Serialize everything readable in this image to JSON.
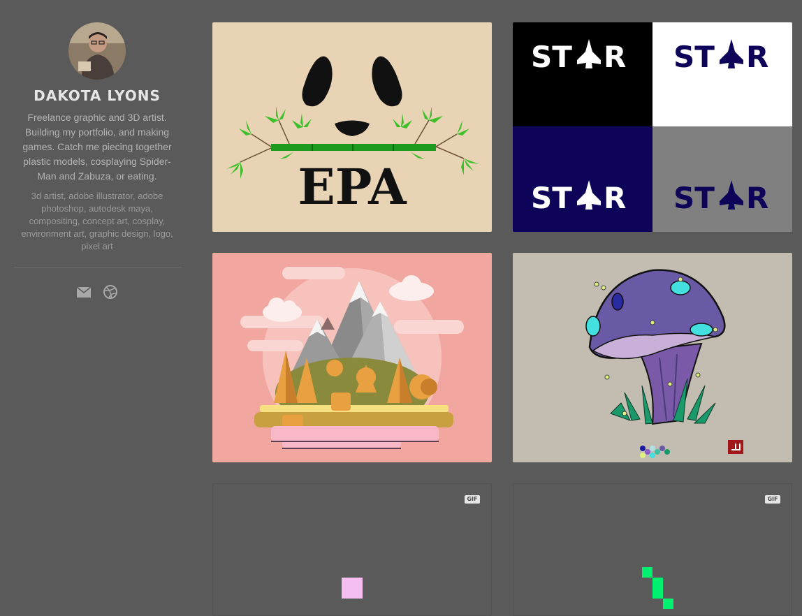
{
  "profile": {
    "name": "DAKOTA LYONS",
    "bio": "Freelance graphic and 3D artist. Building my portfolio, and making games. Catch me piecing together plastic models, cosplaying Spider-Man and Zabuza, or eating.",
    "tags": "3d artist, adobe illustrator, adobe photoshop, autodesk maya, compositing, concept art, cosplay, environment art, graphic design, logo, pixel art"
  },
  "social": [
    {
      "icon": "mail-icon"
    },
    {
      "icon": "dribbble-icon"
    }
  ],
  "projects": [
    {
      "title": "EPA",
      "art_text": "EPA"
    },
    {
      "title": "STAR",
      "art_text": "ST",
      "art_text_end": "R"
    },
    {
      "title": "Mountain landscape"
    },
    {
      "title": "Mushroom"
    },
    {
      "badge": "GIF"
    },
    {
      "badge": "GIF"
    }
  ],
  "colors": {
    "background": "#5a5a5a",
    "epa_bg": "#e8d4b4",
    "star_navy": "#0d0358",
    "landscape_bg": "#f2a6a0",
    "mushroom_bg": "#c2bdb0",
    "gif_pink": "#f5bdf0",
    "gif_green": "#00f070"
  }
}
